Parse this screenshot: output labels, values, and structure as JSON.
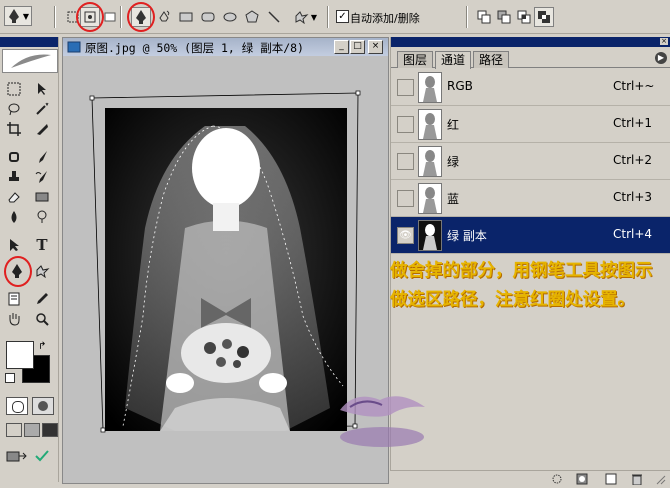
{
  "options_bar": {
    "auto_add_delete_label": "自动添加/删除",
    "auto_add_delete_checked": "✓"
  },
  "document": {
    "title": "原图.jpg @ 50% (图层 1, 绿 副本/8)",
    "btn_min": "_",
    "btn_max": "□",
    "btn_close": "×"
  },
  "panel": {
    "tabs": [
      "图层",
      "通道",
      "路径"
    ],
    "active_tab": "通道",
    "channels": [
      {
        "name": "RGB",
        "shortcut": "Ctrl+~",
        "selected": false
      },
      {
        "name": "红",
        "shortcut": "Ctrl+1",
        "selected": false
      },
      {
        "name": "绿",
        "shortcut": "Ctrl+2",
        "selected": false
      },
      {
        "name": "蓝",
        "shortcut": "Ctrl+3",
        "selected": false
      },
      {
        "name": "绿 副本",
        "shortcut": "Ctrl+4",
        "selected": true
      }
    ]
  },
  "tools": {
    "type_tool": "T"
  },
  "annotation": {
    "text": "做舍掉的部分，用钢笔工具按图示做选区路径，注意红圈处设置。"
  },
  "colors": {
    "title_bar": "#0a246a",
    "annotation": "#e6b400",
    "highlight_ring": "#e02020"
  }
}
